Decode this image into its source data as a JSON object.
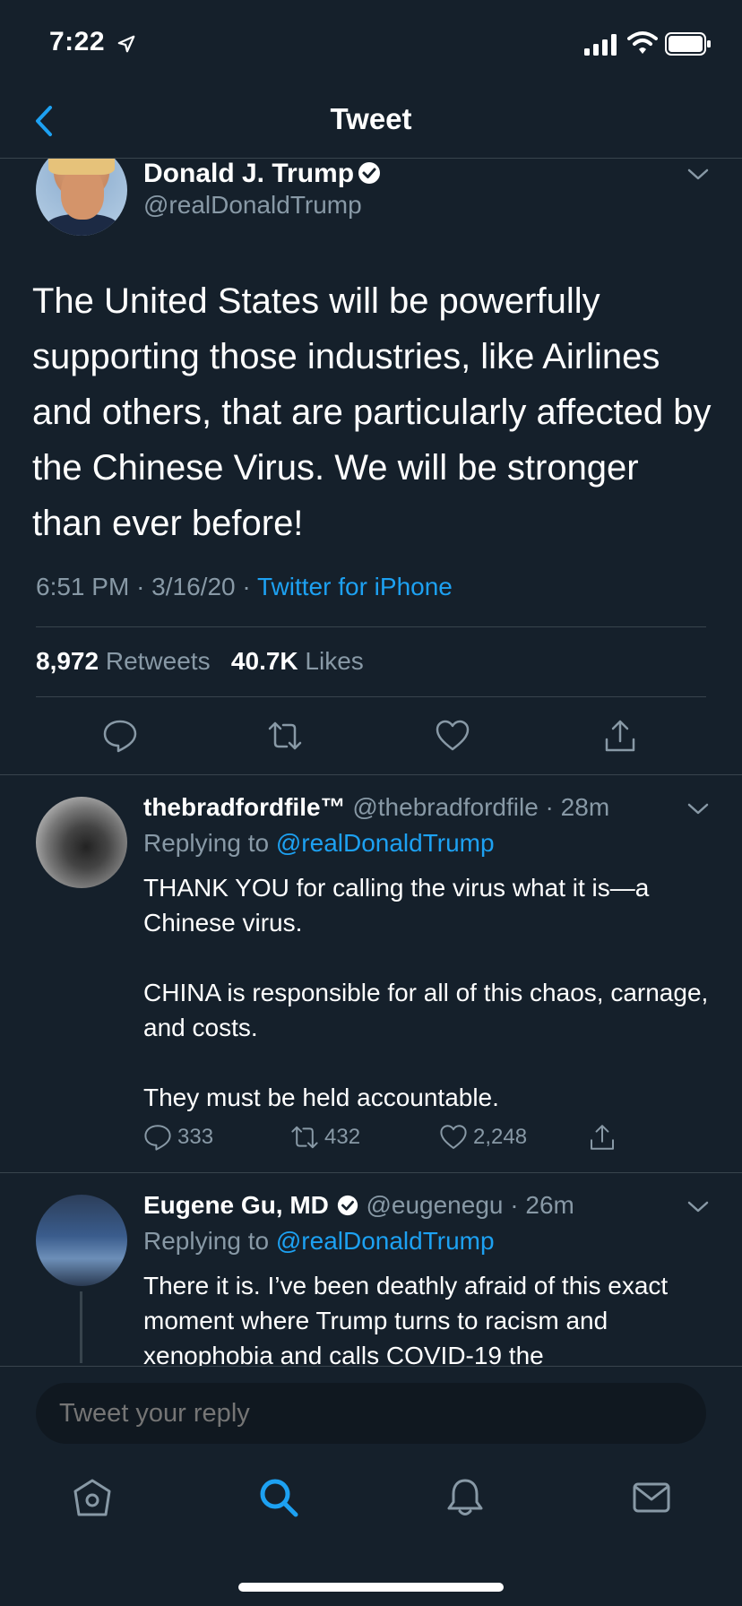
{
  "status_bar": {
    "time": "7:22"
  },
  "nav": {
    "title": "Tweet"
  },
  "main_tweet": {
    "author_name": "Donald J. Trump",
    "author_handle": "@realDonaldTrump",
    "text": "The United States will be powerfully supporting those industries, like Airlines and others, that are particularly affected by the Chinese Virus. We will be stronger than ever before!",
    "time": "6:51 PM",
    "date": "3/16/20",
    "source": "Twitter for iPhone",
    "retweets_count": "8,972",
    "retweets_label": "Retweets",
    "likes_count": "40.7K",
    "likes_label": "Likes"
  },
  "replies": [
    {
      "name": "thebradfordfile™",
      "handle": "@thebradfordfile",
      "age": "28m",
      "replying_prefix": "Replying to",
      "replying_to": "@realDonaldTrump",
      "paragraphs": [
        "THANK YOU for calling the virus what it is—a Chinese virus.",
        "CHINA is responsible for all of this chaos, carnage, and costs.",
        "They must be held accountable."
      ],
      "reply_count": "333",
      "retweet_count": "432",
      "like_count": "2,248"
    },
    {
      "name": "Eugene Gu, MD",
      "handle": "@eugenegu",
      "age": "26m",
      "replying_prefix": "Replying to",
      "replying_to": "@realDonaldTrump",
      "paragraphs": [
        "There it is. I’ve been deathly afraid of this exact moment where Trump turns to racism and xenophobia and calls COVID-19 the"
      ]
    }
  ],
  "composer": {
    "placeholder": "Tweet your reply"
  },
  "colors": {
    "background": "#15202b",
    "accent": "#1da1f2",
    "muted": "#8899a6",
    "border": "#38444d"
  },
  "icons": [
    "back-chevron-icon",
    "verified-badge-icon",
    "caret-down-icon",
    "reply-icon",
    "retweet-icon",
    "like-icon",
    "share-icon",
    "home-icon",
    "search-icon",
    "notifications-icon",
    "messages-icon"
  ]
}
